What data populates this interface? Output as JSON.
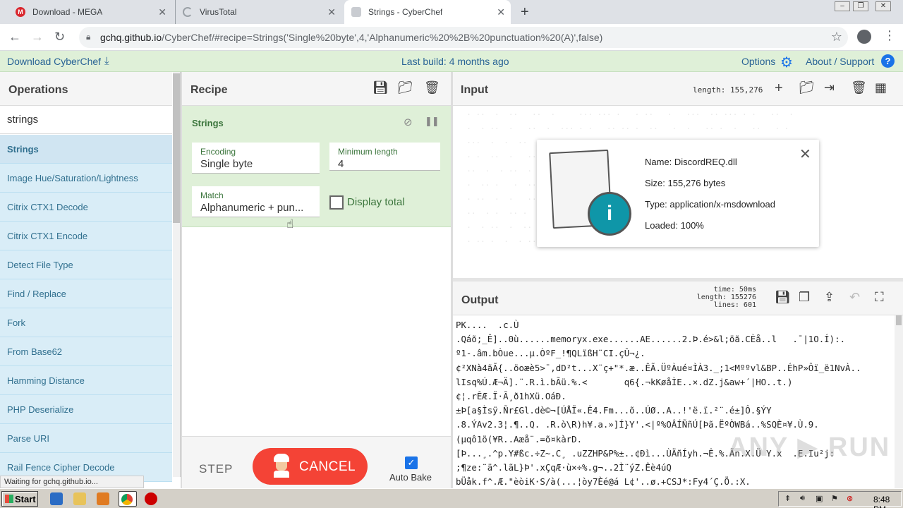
{
  "browser": {
    "tabs": [
      {
        "title": "Download - MEGA",
        "icon": "mega-icon"
      },
      {
        "title": "VirusTotal",
        "icon": "loading-spinner-icon"
      },
      {
        "title": "Strings - CyberChef",
        "icon": "cyberchef-icon"
      }
    ],
    "url_host": "gchq.github.io",
    "url_path": "/CyberChef/#recipe=Strings('Single%20byte',4,'Alphanumeric%20%2B%20punctuation%20(A)',false)"
  },
  "banner": {
    "download_label": "Download CyberChef",
    "last_build": "Last build: 4 months ago",
    "options_label": "Options",
    "about_label": "About / Support"
  },
  "operations": {
    "title": "Operations",
    "search_value": "strings",
    "items": [
      "Strings",
      "Image Hue/Saturation/Lightness",
      "Citrix CTX1 Decode",
      "Citrix CTX1 Encode",
      "Detect File Type",
      "Find / Replace",
      "Fork",
      "From Base62",
      "Hamming Distance",
      "PHP Deserialize",
      "Parse URI",
      "Rail Fence Cipher Decode"
    ]
  },
  "recipe": {
    "title": "Recipe",
    "operation_name": "Strings",
    "encoding_label": "Encoding",
    "encoding_value": "Single byte",
    "min_length_label": "Minimum length",
    "min_length_value": "4",
    "match_label": "Match",
    "match_value": "Alphanumeric + pun...",
    "display_total_label": "Display total",
    "step_label": "STEP",
    "cancel_label": "CANCEL",
    "auto_bake_label": "Auto Bake"
  },
  "input": {
    "title": "Input",
    "length": "length: 155,276",
    "faded_lines": [
      "  . ..  .  ..   ..  .     ... ... .   . ..   .   ...  .. ... . .   ..  .",
      "  .  . ..  .   ..  .  ... . .   .. .. .  ..   .  .   .. .  .   ..   . .",
      "  ...  .  .  ..  . . ..   ...  .  . .   .  ..  . ..  . .   .. .  .. .",
      "  . .  ..  .   ..  . ..  .  .   ..  .  .. .  . .   ..  .  .  .. . . .",
      "  ..  .  . ..  .   .  ..  . .  ..  . ..  .  .  .. . .  .  .. .  .. .",
      "  .  .. .   .  .. .  . ..  .  .. .   .  .  .. . ..  .  . .  .. .  .",
      "  . ..  .  .   ..  .  . .  ..  .  .. .  .  . ..  .  .. . .  .  .. .",
      "  ..  . .  .. .  . ..  .  .  .. . .  ..  . .  .  .. .  . ..  . . ..",
      "  .  . ..  .  .. .  .  .. .  . .  .. .  .  .. . .  .  .. . .  . ..",
      "  . .. .  .  . ..  .  .. .  .  . .. .  .  .. .  . .  .. .  .  .. ."
    ],
    "file": {
      "name": "Name: DiscordREQ.dll",
      "size": "Size: 155,276 bytes",
      "type": "Type: application/x-msdownload",
      "loaded": "Loaded: 100%"
    }
  },
  "output": {
    "title": "Output",
    "time": "time:   50ms",
    "length": "length: 155276",
    "lines": "lines:    601",
    "text_lines": [
      "PK....  .c.Ù",
      ".Qáõ;_Ê]..0ù......memoryx.exe......AE......2.Þ.é>&l;öã.CÈå..l   .¯|1O.Í):.",
      "º1-.âm.bÒue...µ.ÒºF_!¶QLïßH¨CI.çÛ¬¿.",
      "¢²XNà4ãÃ{..öoæè5>¯,dD²t...X¨ç+\"*.æ..ÊÃ.ÜºÀué¤ÌÀ3._;1<Mººvl&BP..ÉhP»Ôï_ë1NvÀ..",
      "lIsq%Ú.Æ¬Ä].¨.R.ì.bÃü.%.<       q6{.¬kKøåÌE..×.dZ.j&aw+´|HO..t.)",
      "¢¦.rÊÆ.Ï·Ã¸ð1hXü.OáÐ.",
      "±Þ[a§Ìsÿ.Ñr£Gl.dè©¬[ÚÅÏ«.Ê4.Fm...õ..ÚØ..A..!'ë.ï.²¨.é±]Ô.§ÝY",
      ".8.ÝAv2.3¦.¶..Q. .R.ò\\R)h¥.a.»]Í}Y'.<|º%OÂÍÑñÚ[Þã.ËºÒWBá..%SQÈ¤¥.Ù.9.",
      "(µqô1ö(¥R..Aæå¨.=õ¤kàrD.",
      "[Þ...¸.^p.Y#ßc.÷Z~.C¸ .uZZHP&P%±..¢Ðì...ÙÄñÍyh.¬Ê.%.Ãn.X.Ü Y.x  .E.Iu²j:",
      ";¶ze:¨ä^.lãL}Þ'.xÇqÆ·ù×÷%.g¬..2Ì¨ýZ.Êè4úQ",
      "bÜåk.f^.Æ.\"èòiK·S/à(...¦òy7Èé@á L¢'..ø.+CSJ*:Fy4´Ç.Ö.:X."
    ]
  },
  "status": {
    "text": "Waiting for gchq.github.io..."
  },
  "taskbar": {
    "start_label": "Start",
    "clock": "8:48 PM"
  }
}
